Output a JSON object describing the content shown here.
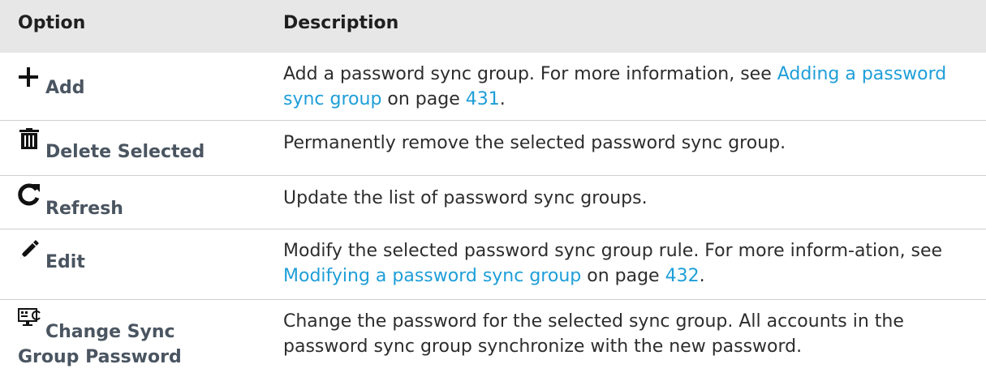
{
  "header": {
    "option": "Option",
    "description": "Description"
  },
  "rows": [
    {
      "option": "Add",
      "icon": "plus-icon",
      "desc_pre": "Add a password sync group. For more information, see ",
      "desc_link": "Adding a password sync group",
      "desc_mid": " on page ",
      "desc_page": "431",
      "desc_post": "."
    },
    {
      "option": "Delete Selected",
      "icon": "trash-icon",
      "desc": "Permanently remove the selected password sync group."
    },
    {
      "option": "Refresh",
      "icon": "refresh-icon",
      "desc": "Update the list of password sync groups."
    },
    {
      "option": "Edit",
      "icon": "pencil-icon",
      "desc_pre": "Modify the selected password sync group rule. For more inform-ation, see ",
      "desc_link": "Modifying a password sync group",
      "desc_mid": " on page ",
      "desc_page": "432",
      "desc_post": "."
    },
    {
      "option_line1": "Change Sync",
      "option_line2": "Group Password",
      "icon": "monitor-sync-icon",
      "desc": "Change the password for the selected sync group. All accounts in the password sync group synchronize with the new password."
    }
  ],
  "colors": {
    "link": "#1e9ed8",
    "header_bg": "#e7e7e7",
    "label": "#4a5561"
  }
}
